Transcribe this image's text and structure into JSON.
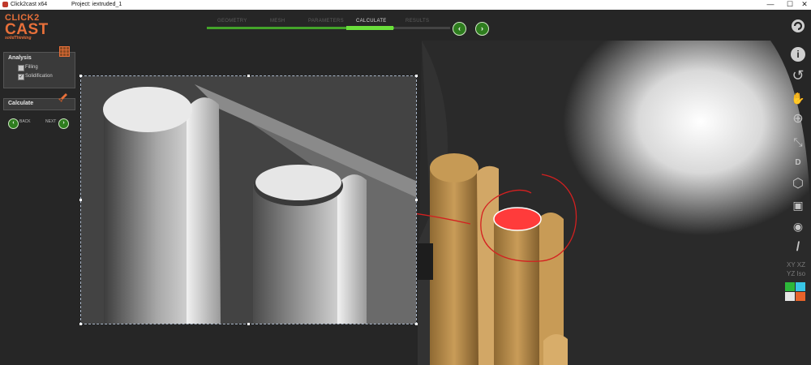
{
  "window": {
    "app_title": "Click2cast x64",
    "project_title": "Project: iextruded_1",
    "minimize_glyph": "—",
    "maximize_glyph": "☐",
    "close_glyph": "✕"
  },
  "logo": {
    "line1": "CLICK2",
    "line2": "CAST",
    "tagline": "solidThinking"
  },
  "steps": [
    {
      "label": "GEOMETRY"
    },
    {
      "label": "MESH"
    },
    {
      "label": "PARAMETERS"
    },
    {
      "label": "CALCULATE"
    },
    {
      "label": "RESULTS"
    }
  ],
  "workflow": {
    "progress_fraction": 0.77,
    "back_glyph": "‹",
    "next_glyph": "›"
  },
  "analysis_panel": {
    "title": "Analysis",
    "options": [
      {
        "label": "Filling",
        "checked": false
      },
      {
        "label": "Solidification",
        "checked": true
      }
    ],
    "check_glyph": "✓"
  },
  "calculate_panel": {
    "title": "Calculate",
    "back_label": "BACK",
    "next_label": "NEXT",
    "back_glyph": "‹",
    "next_glyph": "›"
  },
  "toolbar": {
    "info_glyph": "i",
    "rotate_glyph": "↺",
    "pan_glyph": "✋",
    "zoom_glyph": "⊕",
    "fit_glyph": "⤡",
    "dimension_glyph": "D",
    "view_cube_glyph": "⬡",
    "save_glyph": "▣",
    "camera_glyph": "◉",
    "probe_glyph": "/",
    "axis_row1": "XY XZ",
    "axis_row2": "YZ Iso"
  },
  "colors": {
    "accent": "#e8703a",
    "progress": "#44a42a",
    "highlight_red": "#ff3b3b",
    "casting_gold": "#c69a55",
    "annotation_red": "#d42020"
  },
  "color_swatches": [
    "#2db83a",
    "#38c6e6",
    "#e6e6e6",
    "#e8632a"
  ]
}
